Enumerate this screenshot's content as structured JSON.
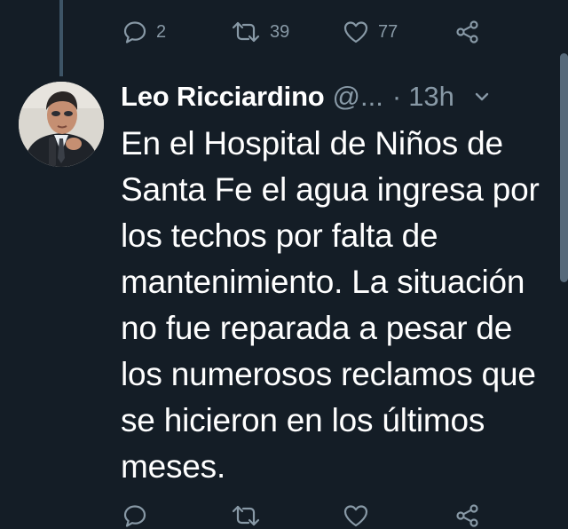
{
  "previous_tweet": {
    "actions": {
      "reply_count": "2",
      "retweet_count": "39",
      "like_count": "77"
    }
  },
  "tweet": {
    "author_name": "Leo Ricciardino",
    "author_handle": "@...",
    "separator": "·",
    "timestamp": "13h",
    "text": "En el Hospital de Niños de Santa Fe el agua ingresa por los techos por falta de mantenimiento. La situación no fue reparada a pesar de los numerosos reclamos que se hicieron en los últimos meses."
  },
  "icons": {
    "reply": "reply-icon",
    "retweet": "retweet-icon",
    "like": "heart-icon",
    "share": "share-icon",
    "menu": "chevron-down-icon"
  },
  "colors": {
    "background": "#141d26",
    "muted_text": "#8899a6",
    "primary_text": "#ffffff",
    "thread_line": "#3d5466"
  }
}
